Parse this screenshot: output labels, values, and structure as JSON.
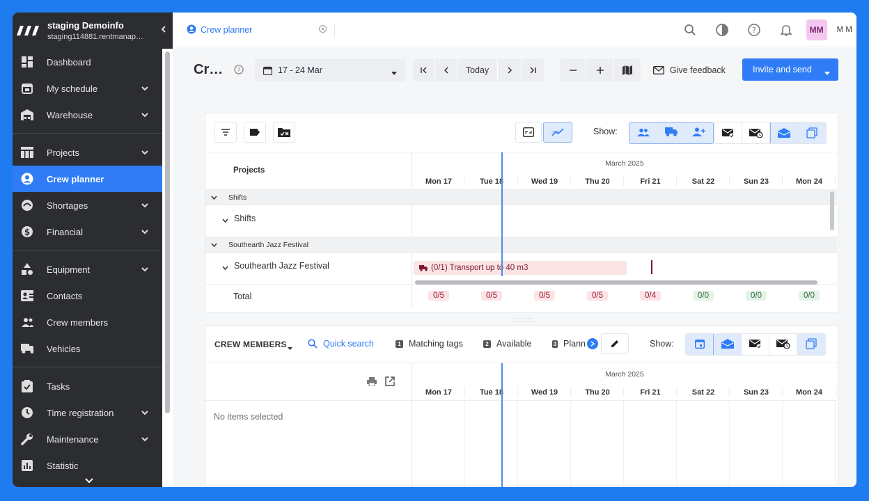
{
  "sidebar": {
    "org_name": "staging Demoinfo",
    "org_url": "staging114881.rentmanap…",
    "items": [
      {
        "label": "Dashboard",
        "icon": "dashboard-icon",
        "chevron": false
      },
      {
        "label": "My schedule",
        "icon": "calendar-icon",
        "chevron": true
      },
      {
        "label": "Warehouse",
        "icon": "warehouse-icon",
        "chevron": true
      },
      {
        "label": "Projects",
        "icon": "projects-icon",
        "chevron": true
      },
      {
        "label": "Crew planner",
        "icon": "user-circle-icon",
        "chevron": false,
        "active": true
      },
      {
        "label": "Shortages",
        "icon": "shortages-icon",
        "chevron": true
      },
      {
        "label": "Financial",
        "icon": "dollar-icon",
        "chevron": true
      },
      {
        "label": "Equipment",
        "icon": "equipment-icon",
        "chevron": true
      },
      {
        "label": "Contacts",
        "icon": "contacts-icon",
        "chevron": false
      },
      {
        "label": "Crew members",
        "icon": "crew-members-icon",
        "chevron": false
      },
      {
        "label": "Vehicles",
        "icon": "truck-icon",
        "chevron": false
      },
      {
        "label": "Tasks",
        "icon": "tasks-icon",
        "chevron": false
      },
      {
        "label": "Time registration",
        "icon": "clock-icon",
        "chevron": true
      },
      {
        "label": "Maintenance",
        "icon": "wrench-icon",
        "chevron": true
      },
      {
        "label": "Statistic",
        "icon": "statistic-icon",
        "chevron": false
      }
    ]
  },
  "topbar": {
    "tab_label": "Crew planner",
    "avatar": "MM",
    "user_initials": "M M"
  },
  "toolbar": {
    "title": "Cr…",
    "date_range": "17 - 24 Mar",
    "today": "Today",
    "feedback": "Give feedback",
    "invite": "Invite and send"
  },
  "planner": {
    "show_label": "Show:",
    "projects_header": "Projects",
    "month": "March 2025",
    "days": [
      "Mon 17",
      "Tue 18",
      "Wed 19",
      "Thu 20",
      "Fri 21",
      "Sat 22",
      "Sun 23",
      "Mon 24"
    ],
    "groups": [
      {
        "band": "Shifts",
        "row": "Shifts"
      },
      {
        "band": "Southearth Jazz Festival",
        "row": "Southearth Jazz Festival"
      }
    ],
    "booking": "(0/1) Transport up to 40 m3",
    "total_label": "Total",
    "totals": [
      {
        "v": "0/5",
        "status": "red"
      },
      {
        "v": "0/5",
        "status": "red"
      },
      {
        "v": "0/5",
        "status": "red"
      },
      {
        "v": "0/5",
        "status": "red"
      },
      {
        "v": "0/4",
        "status": "red"
      },
      {
        "v": "0/0",
        "status": "green"
      },
      {
        "v": "0/0",
        "status": "green"
      },
      {
        "v": "0/0",
        "status": "green"
      }
    ]
  },
  "crew": {
    "title": "CREW MEMBERS",
    "quick_search": "Quick search",
    "filters": [
      {
        "key": "1",
        "label": "Matching tags"
      },
      {
        "key": "2",
        "label": "Available"
      },
      {
        "key": "3",
        "label": "Plann"
      }
    ],
    "show_label": "Show:",
    "month": "March 2025",
    "days": [
      "Mon 17",
      "Tue 18",
      "Wed 19",
      "Thu 20",
      "Fri 21",
      "Sat 22",
      "Sun 23",
      "Mon 24"
    ],
    "empty": "No items selected"
  },
  "colors": {
    "accent": "#2f7cf6",
    "sidebar": "#2b2d31",
    "shortage": "#9b1b30",
    "ok": "#2e6b3a",
    "avatar_bg": "#f4c7ef"
  }
}
